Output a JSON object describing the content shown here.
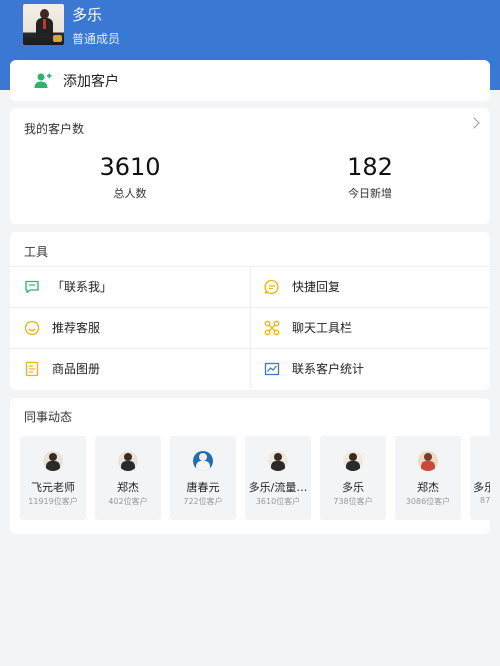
{
  "header": {
    "name": "多乐",
    "role": "普通成员"
  },
  "add_customer": {
    "label": "添加客户"
  },
  "customer_count": {
    "title": "我的客户数",
    "total": {
      "value": "3610",
      "label": "总人数"
    },
    "today": {
      "value": "182",
      "label": "今日新增"
    }
  },
  "tools": {
    "title": "工具",
    "items": [
      {
        "label": "「联系我」",
        "icon": "chat-bubble-icon",
        "color": "#2db36a"
      },
      {
        "label": "快捷回复",
        "icon": "quick-reply-icon",
        "color": "#f0b400"
      },
      {
        "label": "推荐客服",
        "icon": "smiley-icon",
        "color": "#f0b400"
      },
      {
        "label": "聊天工具栏",
        "icon": "toolbar-icon",
        "color": "#f0b400"
      },
      {
        "label": "商品图册",
        "icon": "document-icon",
        "color": "#f0b400"
      },
      {
        "label": "联系客户统计",
        "icon": "chart-icon",
        "color": "#3a78d4"
      }
    ]
  },
  "team": {
    "title": "同事动态",
    "colleagues": [
      {
        "name": "飞元老师",
        "count": "11919位客户"
      },
      {
        "name": "郑杰",
        "count": "402位客户"
      },
      {
        "name": "唐春元",
        "count": "722位客户"
      },
      {
        "name": "多乐/流量…",
        "count": "3610位客户"
      },
      {
        "name": "多乐",
        "count": "738位客户"
      },
      {
        "name": "郑杰",
        "count": "3086位客户"
      },
      {
        "name": "多乐",
        "count": "87"
      }
    ]
  }
}
